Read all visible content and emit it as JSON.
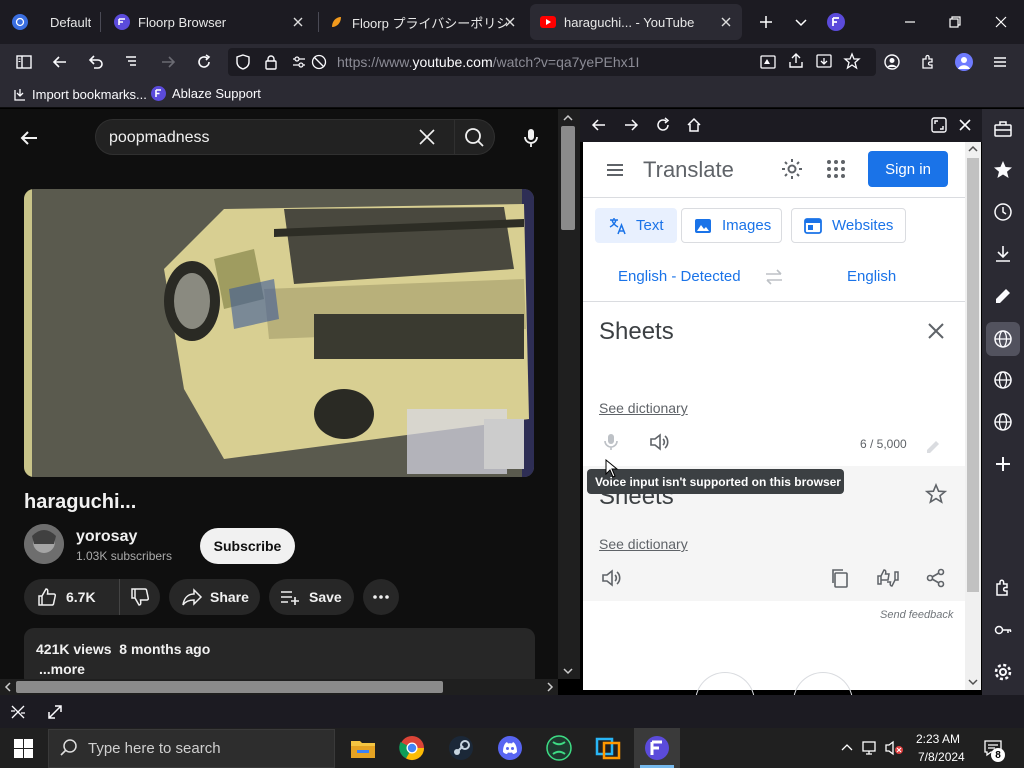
{
  "tabs": [
    {
      "label": "Default"
    },
    {
      "label": "Floorp Browser"
    },
    {
      "label": "Floorp プライバシーポリシー"
    },
    {
      "label": "haraguchi... - YouTube"
    }
  ],
  "url": {
    "prefix": "https://www.",
    "host": "youtube.com",
    "path": "/watch?v=qa7yePEhx1I"
  },
  "bookmarks": [
    {
      "label": "Import bookmarks..."
    },
    {
      "label": "Ablaze Support"
    }
  ],
  "youtube": {
    "search_query": "poopmadness",
    "video_title": "haraguchi...",
    "channel_name": "yorosay",
    "subscribers": "1.03K subscribers",
    "subscribe_label": "Subscribe",
    "likes": "6.7K",
    "share_label": "Share",
    "save_label": "Save",
    "views_line": "421K views  8 months ago",
    "more_label": "...more"
  },
  "translate": {
    "brand": "Translate",
    "signin": "Sign in",
    "tabs": [
      "Text",
      "Images",
      "Websites"
    ],
    "source_lang": "English - Detected",
    "target_lang": "English",
    "source_text": "Sheets",
    "see_dictionary": "See dictionary",
    "char_count": "6 / 5,000",
    "target_text": "Sheets",
    "tooltip": "Voice input isn't supported on this browser",
    "feedback": "Send feedback"
  },
  "taskbar": {
    "search_placeholder": "Type here to search",
    "time": "2:23 AM",
    "date": "7/8/2024",
    "notification_count": "8"
  },
  "colors": {
    "browser_bg": "#2b2a33",
    "youtube_bg": "#0f0f0f",
    "google_blue": "#1a73e8",
    "floorp_accent": "#5b4bdb"
  }
}
